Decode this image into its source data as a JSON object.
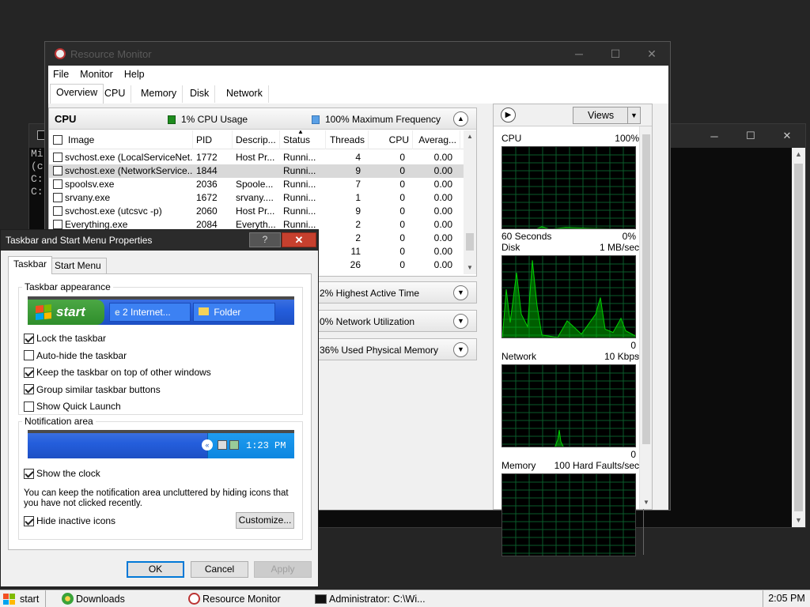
{
  "console": {
    "lines": [
      "Mi",
      "(c",
      "",
      "C:",
      "",
      "C:"
    ]
  },
  "resmon": {
    "title": "Resource Monitor",
    "menu": [
      "File",
      "Monitor",
      "Help"
    ],
    "tabs": [
      "Overview",
      "CPU",
      "Memory",
      "Disk",
      "Network"
    ],
    "cpu_section": {
      "name": "CPU",
      "usage": "1% CPU Usage",
      "usage_color": "#1e8c1e",
      "frequency": "100% Maximum Frequency",
      "frequency_color": "#5aa0e6",
      "columns": [
        "Image",
        "PID",
        "Descrip...",
        "Status",
        "Threads",
        "CPU",
        "Averag..."
      ],
      "rows": [
        {
          "image": "svchost.exe (LocalServiceNet...",
          "pid": "1772",
          "desc": "Host Pr...",
          "status": "Runni...",
          "threads": "4",
          "cpu": "0",
          "avg": "0.00"
        },
        {
          "image": "svchost.exe (NetworkService...",
          "pid": "1844",
          "desc": "",
          "status": "Runni...",
          "threads": "9",
          "cpu": "0",
          "avg": "0.00"
        },
        {
          "image": "spoolsv.exe",
          "pid": "2036",
          "desc": "Spoole...",
          "status": "Runni...",
          "threads": "7",
          "cpu": "0",
          "avg": "0.00"
        },
        {
          "image": "srvany.exe",
          "pid": "1672",
          "desc": "srvany....",
          "status": "Runni...",
          "threads": "1",
          "cpu": "0",
          "avg": "0.00"
        },
        {
          "image": "svchost.exe (utcsvc -p)",
          "pid": "2060",
          "desc": "Host Pr...",
          "status": "Runni...",
          "threads": "9",
          "cpu": "0",
          "avg": "0.00"
        },
        {
          "image": "Everything.exe",
          "pid": "2084",
          "desc": "Everyth...",
          "status": "Runni...",
          "threads": "2",
          "cpu": "0",
          "avg": "0.00"
        },
        {
          "image": "",
          "pid": "",
          "desc": "",
          "status": "",
          "threads": "2",
          "cpu": "0",
          "avg": "0.00"
        },
        {
          "image": "",
          "pid": "",
          "desc": "",
          "status": "",
          "threads": "11",
          "cpu": "0",
          "avg": "0.00"
        },
        {
          "image": "",
          "pid": "",
          "desc": "",
          "status": "",
          "threads": "26",
          "cpu": "0",
          "avg": "0.00"
        }
      ]
    },
    "disk_summary": "2% Highest Active Time",
    "network_summary": "0% Network Utilization",
    "memory_summary": "36% Used Physical Memory",
    "views_label": "Views",
    "graphs": [
      {
        "name": "CPU",
        "max": "100%",
        "bottom_left": "60 Seconds",
        "bottom_right": "0%"
      },
      {
        "name": "Disk",
        "max": "1 MB/sec",
        "bottom_left": "",
        "bottom_right": "0"
      },
      {
        "name": "Network",
        "max": "10 Kbps",
        "bottom_left": "",
        "bottom_right": "0"
      },
      {
        "name": "Memory",
        "max": "100 Hard Faults/sec",
        "bottom_left": "",
        "bottom_right": ""
      }
    ],
    "graph_color": "#00d000"
  },
  "dialog": {
    "title": "Taskbar and Start Menu Properties",
    "help": "?",
    "close": "✕",
    "tabs": [
      "Taskbar",
      "Start Menu"
    ],
    "appearance_group": "Taskbar appearance",
    "preview": {
      "start": "start",
      "task1": "2 Internet...",
      "task2": "Folder"
    },
    "options": [
      {
        "label": "Lock the taskbar",
        "checked": true
      },
      {
        "label": "Auto-hide the taskbar",
        "checked": false
      },
      {
        "label": "Keep the taskbar on top of other windows",
        "checked": true
      },
      {
        "label": "Group similar taskbar buttons",
        "checked": true
      },
      {
        "label": "Show Quick Launch",
        "checked": false
      }
    ],
    "notification_group": "Notification area",
    "tray_time": "1:23 PM",
    "show_clock": {
      "label": "Show the clock",
      "checked": true
    },
    "info_text": "You can keep the notification area uncluttered by hiding icons that you have not clicked recently.",
    "hide_inactive": {
      "label": "Hide inactive icons",
      "checked": true
    },
    "customize": "Customize...",
    "ok": "OK",
    "cancel": "Cancel",
    "apply": "Apply"
  },
  "taskbar": {
    "start": "start",
    "items": [
      "Downloads",
      "Resource Monitor",
      "Administrator: C:\\Wi..."
    ],
    "clock": "2:05 PM"
  }
}
